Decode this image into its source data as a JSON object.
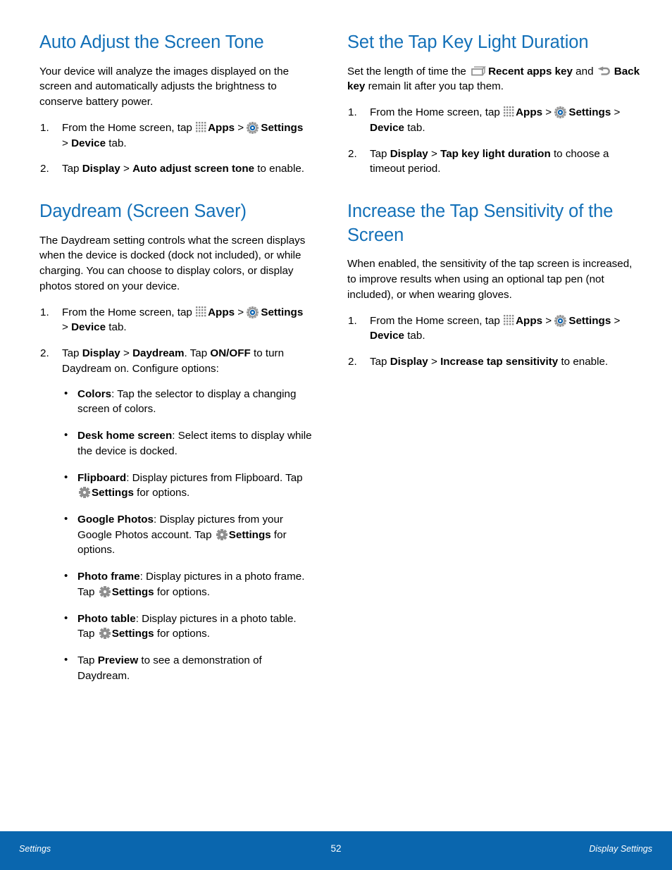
{
  "document": {
    "page_number": "52",
    "heading_color": "#1370b8",
    "footer_color": "#0a66ae"
  },
  "columns": {
    "left": {
      "sections": [
        {
          "heading": "Auto Adjust the Screen Tone",
          "intro": "Your device will analyze the images displayed on the screen and automatically adjusts the brightness to conserve battery power.",
          "steps": [
            {
              "parts": [
                {
                  "type": "text",
                  "text": "From the Home screen, tap "
                },
                {
                  "type": "icon",
                  "icon": "apps-grid-icon"
                },
                {
                  "type": "bold",
                  "text": "Apps"
                },
                {
                  "type": "text",
                  "text": " > "
                },
                {
                  "type": "icon",
                  "icon": "settings-gear-blue-icon"
                },
                {
                  "type": "bold",
                  "text": "Settings"
                },
                {
                  "type": "text",
                  "text": " > "
                },
                {
                  "type": "bold",
                  "text": "Device"
                },
                {
                  "type": "text",
                  "text": " tab."
                }
              ]
            },
            {
              "parts": [
                {
                  "type": "text",
                  "text": "Tap "
                },
                {
                  "type": "bold",
                  "text": "Display"
                },
                {
                  "type": "text",
                  "text": " > "
                },
                {
                  "type": "bold",
                  "text": "Auto adjust screen tone"
                },
                {
                  "type": "text",
                  "text": " to enable."
                }
              ]
            }
          ]
        },
        {
          "heading": "Daydream (Screen Saver)",
          "intro": "The Daydream setting controls what the screen displays when the device is docked (dock not included), or while charging. You can choose to display colors, or display photos stored on your device.",
          "steps": [
            {
              "parts": [
                {
                  "type": "text",
                  "text": "From the Home screen, tap "
                },
                {
                  "type": "icon",
                  "icon": "apps-grid-icon"
                },
                {
                  "type": "bold",
                  "text": "Apps"
                },
                {
                  "type": "text",
                  "text": " > "
                },
                {
                  "type": "icon",
                  "icon": "settings-gear-blue-icon"
                },
                {
                  "type": "bold",
                  "text": "Settings"
                },
                {
                  "type": "text",
                  "text": " > "
                },
                {
                  "type": "bold",
                  "text": "Device"
                },
                {
                  "type": "text",
                  "text": " tab."
                }
              ]
            },
            {
              "parts": [
                {
                  "type": "text",
                  "text": "Tap "
                },
                {
                  "type": "bold",
                  "text": "Display"
                },
                {
                  "type": "text",
                  "text": " > "
                },
                {
                  "type": "bold",
                  "text": "Daydream"
                },
                {
                  "type": "text",
                  "text": ". Tap "
                },
                {
                  "type": "bold",
                  "text": "ON/OFF"
                },
                {
                  "type": "text",
                  "text": " to turn Daydream on. Configure options:"
                }
              ],
              "bullets": [
                {
                  "parts": [
                    {
                      "type": "bold",
                      "text": "Colors"
                    },
                    {
                      "type": "text",
                      "text": ": Tap the selector to display a changing screen of colors."
                    }
                  ]
                },
                {
                  "parts": [
                    {
                      "type": "bold",
                      "text": "Desk home screen"
                    },
                    {
                      "type": "text",
                      "text": ": Select items to display while the device is docked."
                    }
                  ]
                },
                {
                  "parts": [
                    {
                      "type": "bold",
                      "text": "Flipboard"
                    },
                    {
                      "type": "text",
                      "text": ": Display pictures from Flipboard. Tap "
                    },
                    {
                      "type": "icon",
                      "icon": "gear-icon"
                    },
                    {
                      "type": "bold",
                      "text": "Settings"
                    },
                    {
                      "type": "text",
                      "text": " for options."
                    }
                  ]
                },
                {
                  "parts": [
                    {
                      "type": "bold",
                      "text": "Google Photos"
                    },
                    {
                      "type": "text",
                      "text": ": Display pictures from your Google Photos account. Tap "
                    },
                    {
                      "type": "icon",
                      "icon": "gear-icon"
                    },
                    {
                      "type": "bold",
                      "text": "Settings"
                    },
                    {
                      "type": "text",
                      "text": " for options."
                    }
                  ]
                },
                {
                  "parts": [
                    {
                      "type": "bold",
                      "text": "Photo frame"
                    },
                    {
                      "type": "text",
                      "text": ": Display pictures in a photo frame. Tap "
                    },
                    {
                      "type": "icon",
                      "icon": "gear-icon"
                    },
                    {
                      "type": "bold",
                      "text": "Settings"
                    },
                    {
                      "type": "text",
                      "text": " for options."
                    }
                  ]
                },
                {
                  "parts": [
                    {
                      "type": "bold",
                      "text": "Photo table"
                    },
                    {
                      "type": "text",
                      "text": ": Display pictures in a photo table. Tap "
                    },
                    {
                      "type": "icon",
                      "icon": "gear-icon"
                    },
                    {
                      "type": "bold",
                      "text": "Settings"
                    },
                    {
                      "type": "text",
                      "text": " for options."
                    }
                  ]
                },
                {
                  "parts": [
                    {
                      "type": "text",
                      "text": "Tap "
                    },
                    {
                      "type": "bold",
                      "text": "Preview"
                    },
                    {
                      "type": "text",
                      "text": " to see a demonstration of Daydream."
                    }
                  ]
                }
              ]
            }
          ]
        }
      ]
    },
    "right": {
      "sections": [
        {
          "heading": "Set the Tap Key Light Duration",
          "intro_parts": [
            {
              "type": "text",
              "text": "Set the length of time the "
            },
            {
              "type": "icon",
              "icon": "recent-apps-key-icon"
            },
            {
              "type": "bold",
              "text": "Recent apps key"
            },
            {
              "type": "text",
              "text": " and "
            },
            {
              "type": "icon",
              "icon": "back-key-icon"
            },
            {
              "type": "bold",
              "text": "Back key"
            },
            {
              "type": "text",
              "text": " remain lit after you tap them."
            }
          ],
          "steps": [
            {
              "parts": [
                {
                  "type": "text",
                  "text": "From the Home screen, tap "
                },
                {
                  "type": "icon",
                  "icon": "apps-grid-icon"
                },
                {
                  "type": "bold",
                  "text": "Apps"
                },
                {
                  "type": "text",
                  "text": " > "
                },
                {
                  "type": "icon",
                  "icon": "settings-gear-blue-icon"
                },
                {
                  "type": "bold",
                  "text": "Settings"
                },
                {
                  "type": "text",
                  "text": " > "
                },
                {
                  "type": "bold",
                  "text": "Device"
                },
                {
                  "type": "text",
                  "text": " tab."
                }
              ]
            },
            {
              "parts": [
                {
                  "type": "text",
                  "text": "Tap "
                },
                {
                  "type": "bold",
                  "text": "Display"
                },
                {
                  "type": "text",
                  "text": " > "
                },
                {
                  "type": "bold",
                  "text": "Tap key light duration"
                },
                {
                  "type": "text",
                  "text": " to choose a timeout period."
                }
              ]
            }
          ]
        },
        {
          "heading": "Increase the Tap Sensitivity of the Screen",
          "intro": "When enabled, the sensitivity of the tap screen is increased, to improve results when using an optional tap pen (not included), or when wearing gloves.",
          "steps": [
            {
              "parts": [
                {
                  "type": "text",
                  "text": "From the Home screen, tap "
                },
                {
                  "type": "icon",
                  "icon": "apps-grid-icon"
                },
                {
                  "type": "bold",
                  "text": "Apps"
                },
                {
                  "type": "text",
                  "text": " > "
                },
                {
                  "type": "icon",
                  "icon": "settings-gear-blue-icon"
                },
                {
                  "type": "bold",
                  "text": "Settings"
                },
                {
                  "type": "text",
                  "text": " > "
                },
                {
                  "type": "bold",
                  "text": "Device"
                },
                {
                  "type": "text",
                  "text": " tab."
                }
              ]
            },
            {
              "parts": [
                {
                  "type": "text",
                  "text": "Tap "
                },
                {
                  "type": "bold",
                  "text": "Display"
                },
                {
                  "type": "text",
                  "text": " > "
                },
                {
                  "type": "bold",
                  "text": "Increase tap sensitivity"
                },
                {
                  "type": "text",
                  "text": " to enable."
                }
              ]
            }
          ]
        }
      ]
    }
  },
  "footer": {
    "left_label": "Settings",
    "page_number": "52",
    "right_label": "Display Settings"
  }
}
